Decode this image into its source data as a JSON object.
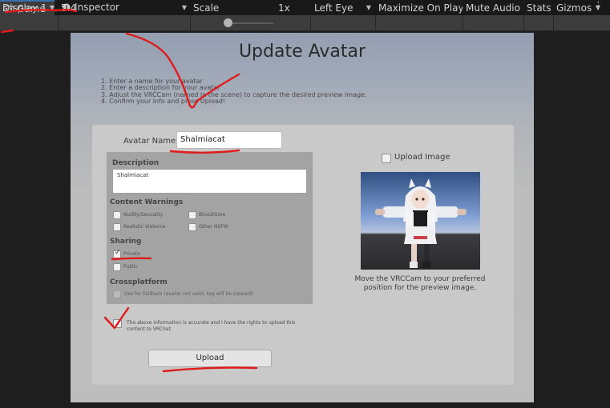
{
  "tabs": [
    {
      "label": "Game",
      "icon": "gamepad-icon"
    },
    {
      "label": "Inspector",
      "icon": "info-icon"
    }
  ],
  "toolbar": {
    "display": "Display 1",
    "aspect": "5:4",
    "scale_label": "Scale",
    "scale_value": "1x",
    "eye": "Left Eye",
    "maximize": "Maximize On Play",
    "mute": "Mute Audio",
    "stats": "Stats",
    "gizmos": "Gizmos"
  },
  "form": {
    "title": "Update Avatar",
    "instructions": [
      "1. Enter a name for your avatar",
      "2. Enter a description for your avatar",
      "3. Adjust the VRCCam (named in the scene) to capture the desired preview image.",
      "4. Confirm your info and press Upload!"
    ],
    "avatar_name_label": "Avatar Name",
    "avatar_name_value": "Shalmiacat",
    "description_label": "Description",
    "description_value": "Shalmiacat",
    "content_warnings_label": "Content Warnings",
    "warnings": {
      "nudity": "Nudity/Sexuality",
      "blood": "Blood/Gore",
      "violence": "Realistic Violence",
      "other": "Other NSFW"
    },
    "sharing_label": "Sharing",
    "sharing": {
      "private": "Private",
      "public": "Public",
      "selected": "Private"
    },
    "crossplatform_label": "Crossplatform",
    "fallback_label": "Use for Fallback (avatar not valid, tag will be cleared)",
    "upload_image_label": "Upload Image",
    "preview_caption": "Move the VRCCam to your preferred position for the preview image.",
    "agree_text": "The above information is accurate and I have the rights to upload this content to VRChat.",
    "upload_button": "Upload"
  },
  "colors": {
    "annotation_red": "#e01b1b",
    "editor_bg": "#1e1e1e",
    "toolbar_bg": "#3c3c3c"
  }
}
